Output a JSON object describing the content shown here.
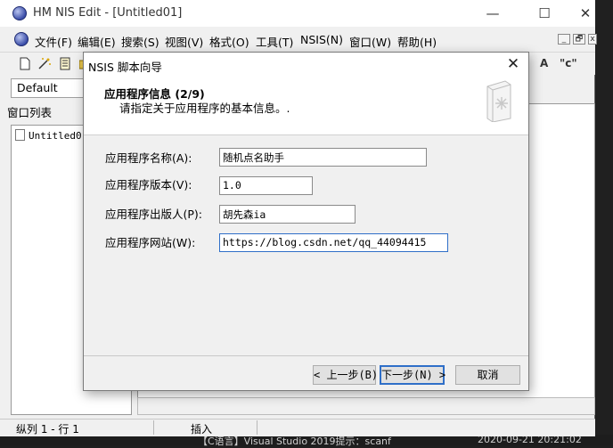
{
  "window": {
    "title": "HM NIS Edit - [Untitled01]",
    "controls": {
      "minimize": "—",
      "maximize": "☐",
      "close": "✕"
    }
  },
  "menubar": {
    "items": [
      "文件(F)",
      "编辑(E)",
      "搜索(S)",
      "视图(V)",
      "格式(O)",
      "工具(T)",
      "NSIS(N)",
      "窗口(W)",
      "帮助(H)"
    ],
    "mdi_controls": [
      "_",
      "🗗",
      "x"
    ]
  },
  "toolbar": {
    "combo_value": "Default",
    "right_icons": [
      "A",
      "\"c\""
    ]
  },
  "panel": {
    "header": "窗口列表",
    "items": [
      "Untitled0"
    ]
  },
  "statusbar": {
    "position": "纵列 1 - 行 1",
    "mode": "插入"
  },
  "background_text": {
    "bottom_left": "【C语言】Visual Studio 2019提示：scanf",
    "bottom_right": "2020-09-21 20:21:02"
  },
  "dialog": {
    "title": "NSIS 脚本向导",
    "close": "✕",
    "heading": "应用程序信息 (2/9)",
    "subheading": "请指定关于应用程序的基本信息。.",
    "fields": [
      {
        "label": "应用程序名称(A):",
        "value": "随机点名助手"
      },
      {
        "label": "应用程序版本(V):",
        "value": "1.0"
      },
      {
        "label": "应用程序出版人(P):",
        "value": "胡先森ia"
      },
      {
        "label": "应用程序网站(W):",
        "value": "https://blog.csdn.net/qq_44094415"
      }
    ],
    "buttons": {
      "back": "< 上一步(B)",
      "next": "下一步(N) >",
      "cancel": "取消"
    }
  }
}
